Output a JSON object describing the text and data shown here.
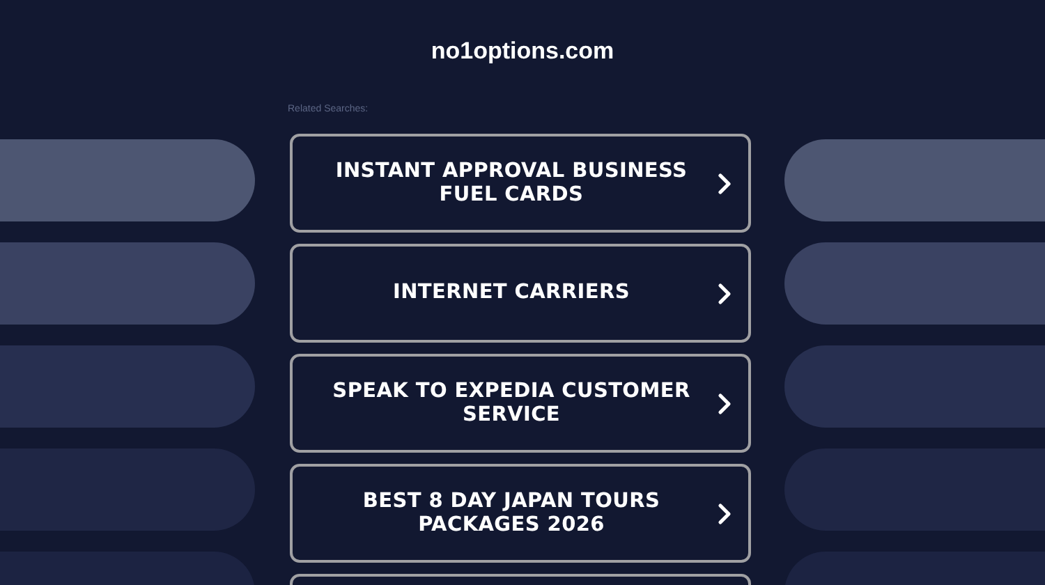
{
  "header": {
    "domain": "no1options.com"
  },
  "related": {
    "label": "Related Searches:",
    "links": [
      {
        "text": "INSTANT APPROVAL BUSINESS FUEL CARDS"
      },
      {
        "text": "INTERNET CARRIERS"
      },
      {
        "text": "SPEAK TO EXPEDIA CUSTOMER SERVICE"
      },
      {
        "text": "BEST 8 DAY JAPAN TOURS PACKAGES 2026"
      }
    ]
  }
}
